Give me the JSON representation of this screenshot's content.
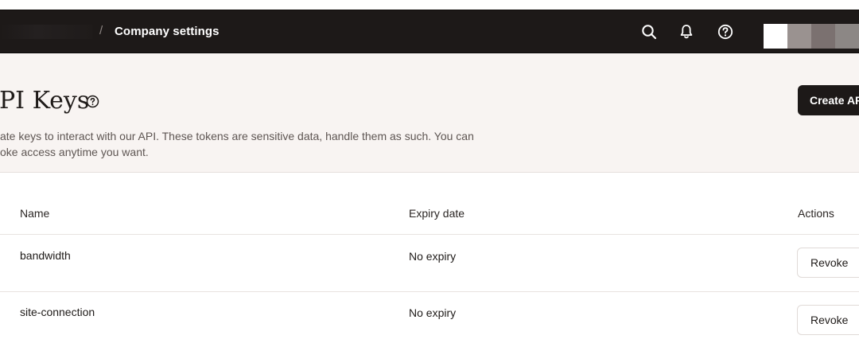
{
  "navbar": {
    "separator": "/",
    "title": "Company settings",
    "icons": {
      "search": "search-icon",
      "notifications": "bell-icon",
      "help": "help-circle-icon"
    }
  },
  "header": {
    "title": "PI Keys",
    "description_line1": "ate keys to interact with our API. These tokens are sensitive data, handle them as such. You can",
    "description_line2": "oke access anytime you want.",
    "create_button": "Create AP"
  },
  "table": {
    "columns": {
      "name": "Name",
      "expiry": "Expiry date",
      "actions": "Actions"
    },
    "rows": [
      {
        "name": "bandwidth",
        "expiry": "No expiry",
        "action": "Revoke"
      },
      {
        "name": "site-connection",
        "expiry": "No expiry",
        "action": "Revoke"
      }
    ]
  },
  "colors": {
    "navbar_bg": "#1d1918",
    "header_bg": "#f8f4f2",
    "primary_button": "#1d1918"
  }
}
